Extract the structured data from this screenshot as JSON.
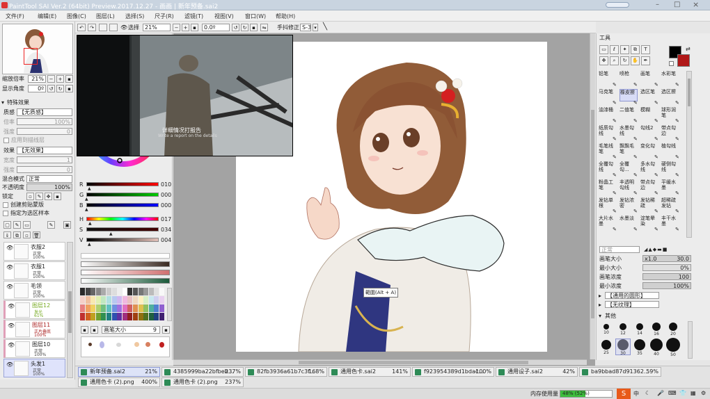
{
  "window": {
    "title": "PaintTool SAI Ver.2 (64bit) Preview.2017.12.27 - 画画 | 新年预备.sai2"
  },
  "menu": [
    "文件(F)",
    "编辑(E)",
    "图像(C)",
    "图层(L)",
    "选择(S)",
    "尺子(R)",
    "滤镜(T)",
    "视图(V)",
    "窗口(W)",
    "帮助(H)"
  ],
  "toolbar": {
    "select_label": "选择",
    "zoom": "21%",
    "angle": "0.0º",
    "stabilizer_label": "手抖修正",
    "stabilizer_value": "S-3"
  },
  "navigator": {
    "zoom_label": "缩放倍率",
    "zoom_value": "21%",
    "angle_label": "显示角度",
    "angle_value": "0º"
  },
  "effects": {
    "section": "特殊效果",
    "texture_label": "质感",
    "texture_value": "【无质感】",
    "scale_label": "倍率",
    "scale_value": "100%",
    "strength_label": "强度",
    "strength_value": "0",
    "checkbox_label": "应用到描线层",
    "effect_label": "效果",
    "effect_value": "【无效果】",
    "width_label": "宽度",
    "width_value": "1",
    "strength2_label": "强度",
    "strength2_value": "0"
  },
  "layer_props": {
    "blend_label": "混合模式",
    "blend_value": "正常",
    "opacity_label": "不透明度",
    "opacity_value": "100%",
    "lock_label": "锁定",
    "clip_label": "创建剪贴蒙版",
    "mask_label": "指定为选区样本"
  },
  "layers": [
    {
      "name": "衣服2",
      "mode": "正常",
      "opacity": "100%"
    },
    {
      "name": "衣服1",
      "mode": "正常",
      "opacity": "100%"
    },
    {
      "name": "毛领",
      "mode": "正常",
      "opacity": "100%"
    },
    {
      "name": "图层12",
      "mode": "发光",
      "opacity": "61%"
    },
    {
      "name": "图层11",
      "mode": "正片叠底",
      "opacity": "100%"
    },
    {
      "name": "图层10",
      "mode": "正常",
      "opacity": "100%"
    },
    {
      "name": "头发1",
      "mode": "正常",
      "opacity": "100%"
    }
  ],
  "color": {
    "current": "#000000",
    "secondary": "#b01818",
    "sliders": [
      {
        "label": "R",
        "value": "010",
        "fraction": 0.04
      },
      {
        "label": "G",
        "value": "000",
        "fraction": 0.0
      },
      {
        "label": "B",
        "value": "000",
        "fraction": 0.0
      },
      {
        "label": "H",
        "value": "017",
        "fraction": 0.05
      },
      {
        "label": "S",
        "value": "034",
        "fraction": 0.34
      },
      {
        "label": "V",
        "value": "004",
        "fraction": 0.04
      }
    ],
    "brush_size_label": "画笔大小",
    "brush_size_value": "9"
  },
  "video_overlay": {
    "subtitle_cn": "详细情况打报告",
    "subtitle_en": "Write a report on the details"
  },
  "tooltip": "範圍(Alt + A)",
  "tools": {
    "header": "工具",
    "brushes": [
      "铅笔",
      "喷枪",
      "画笔",
      "水彩笔",
      "马克笔",
      "橡皮擦",
      "选区笔",
      "选区擦",
      "油漆桶",
      "二值笔",
      "模糊",
      "球形润笔",
      "纸质勾线",
      "水墨勾线",
      "勾线2",
      "带点勾边",
      "毛笔线笔",
      "飘飘毛笔",
      "变化勾",
      "植勾线",
      "全覆勾线",
      "全覆勾...",
      "多水勾线",
      "硬侧勾线",
      "粉晶工笔",
      "丰透明勾线",
      "带点勾边",
      "平缓水墨",
      "发钻单根",
      "发钻浓密",
      "发钻稀疏",
      "超稀疏发钻",
      "大片水墨",
      "水墨淡",
      "淀笔晕染",
      "丰干水墨"
    ],
    "mode_value": "正常",
    "brush_size_label": "画笔大小",
    "brush_size_mult": "x1.0",
    "brush_size_value": "30.0",
    "min_size_label": "最小大小",
    "min_size_value": "0%",
    "density_label": "画笔浓度",
    "density_value": "100",
    "min_density_label": "最小浓度",
    "min_density_value": "100%",
    "shape_value": "【通用的圆形】",
    "texture_value": "【无纹理】",
    "other_label": "其他",
    "dot_sizes": [
      "10",
      "12",
      "14",
      "16",
      "20",
      "25",
      "30",
      "35",
      "40",
      "50"
    ]
  },
  "tabs": [
    {
      "name": "新年预备.sai2",
      "pct": "21%"
    },
    {
      "name": "4385999ba22bfbeb...",
      "pct": "237%"
    },
    {
      "name": "82fb3936a61b7c3f...",
      "pct": "168%"
    },
    {
      "name": "通用色卡.sai2",
      "pct": "141%"
    },
    {
      "name": "f923954389d1bdac...",
      "pct": "100%"
    },
    {
      "name": "通用设子.sai2",
      "pct": "42%"
    },
    {
      "name": "ba9bbad87d91362...",
      "pct": "59%"
    },
    {
      "name": "通用色卡 (2).png",
      "pct": "400%"
    },
    {
      "name": "通用色卡 (2).png",
      "pct": "237%"
    }
  ],
  "status": {
    "memory_label": "内存使用量",
    "memory_value": "48% (52%)",
    "memory_fraction": 0.48,
    "ime": "中"
  }
}
